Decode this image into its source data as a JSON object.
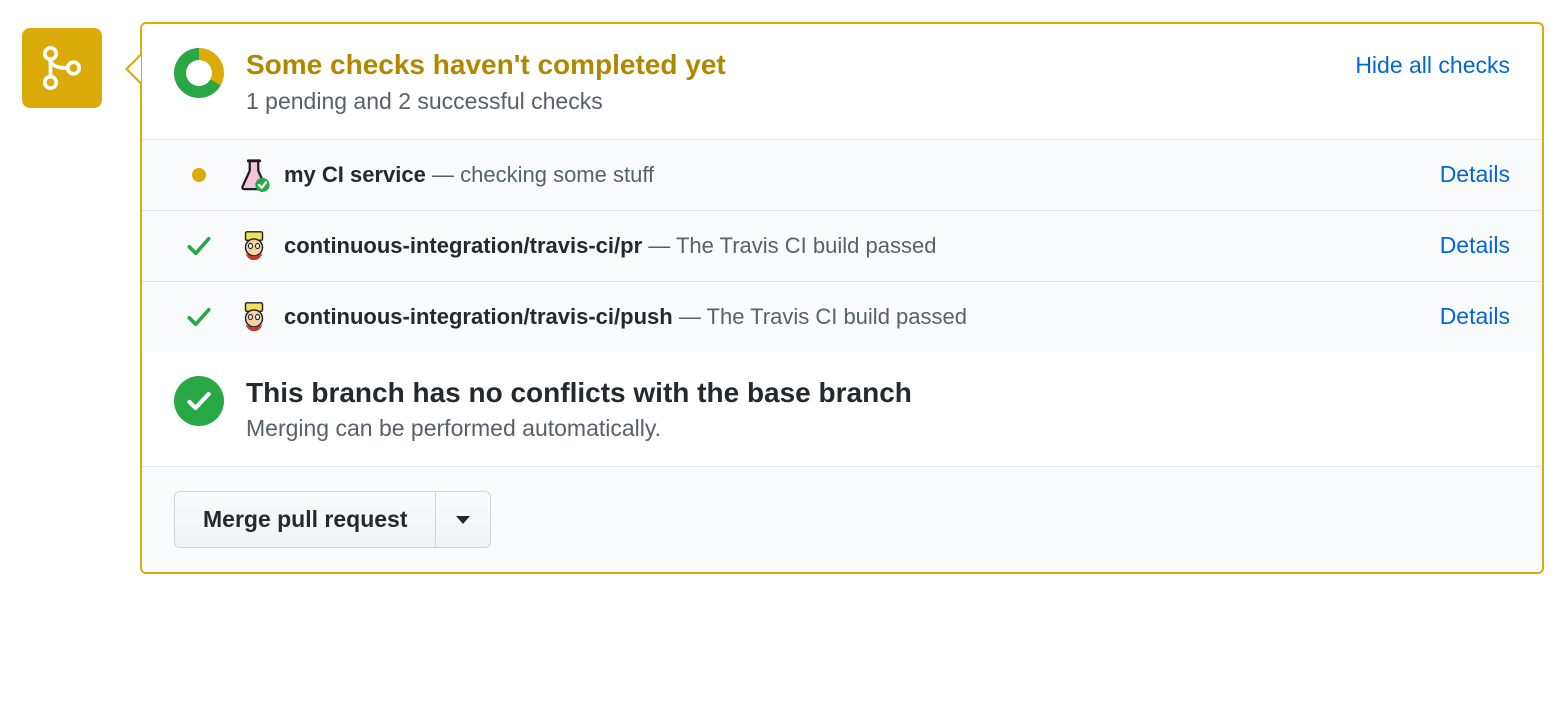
{
  "status": {
    "title": "Some checks haven't completed yet",
    "subtitle": "1 pending and 2 successful checks",
    "hide_link": "Hide all checks"
  },
  "checks": [
    {
      "state": "pending",
      "icon": "flask",
      "name": "my CI service",
      "desc": "checking some stuff",
      "details": "Details"
    },
    {
      "state": "success",
      "icon": "travis",
      "name": "continuous-integration/travis-ci/pr",
      "desc": "The Travis CI build passed",
      "details": "Details"
    },
    {
      "state": "success",
      "icon": "travis",
      "name": "continuous-integration/travis-ci/push",
      "desc": "The Travis CI build passed",
      "details": "Details"
    }
  ],
  "mergeability": {
    "title": "This branch has no conflicts with the base branch",
    "subtitle": "Merging can be performed automatically."
  },
  "actions": {
    "merge_button": "Merge pull request"
  }
}
